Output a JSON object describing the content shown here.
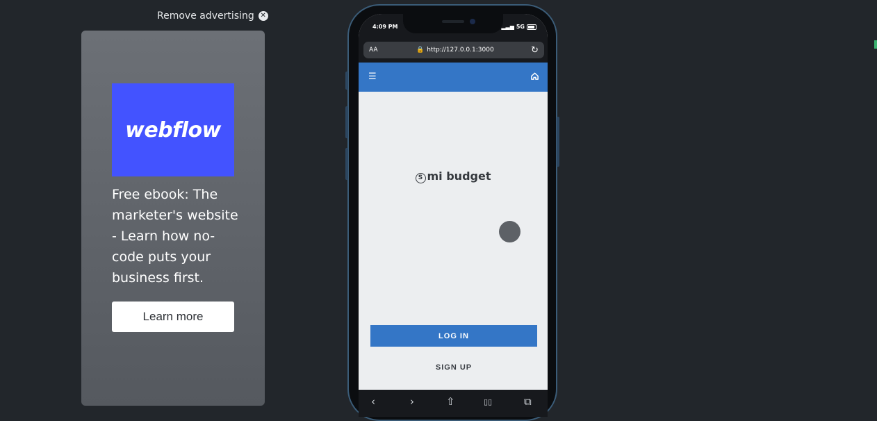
{
  "ad": {
    "remove_label": "Remove advertising",
    "logo_text": "webflow",
    "body": "Free ebook: The marketer's website - Learn how no-code puts your business first.",
    "cta": "Learn more",
    "brand_color": "#4353ff"
  },
  "phone": {
    "status": {
      "time": "4:09 PM",
      "network": "5G"
    },
    "browser": {
      "aa": "AA",
      "url": "http://127.0.0.1:3000"
    },
    "app": {
      "menu_icon": "menu-collapse-icon",
      "home_icon": "home-icon",
      "brand_symbol": "S",
      "brand_name": "mi budget",
      "login_label": "LOG IN",
      "signup_label": "SIGN UP",
      "primary_color": "#3476c6"
    },
    "toolbar": {
      "back": "‹",
      "forward": "›",
      "share": "⇧",
      "bookmarks": "▯▯",
      "tabs": "⧉"
    }
  }
}
